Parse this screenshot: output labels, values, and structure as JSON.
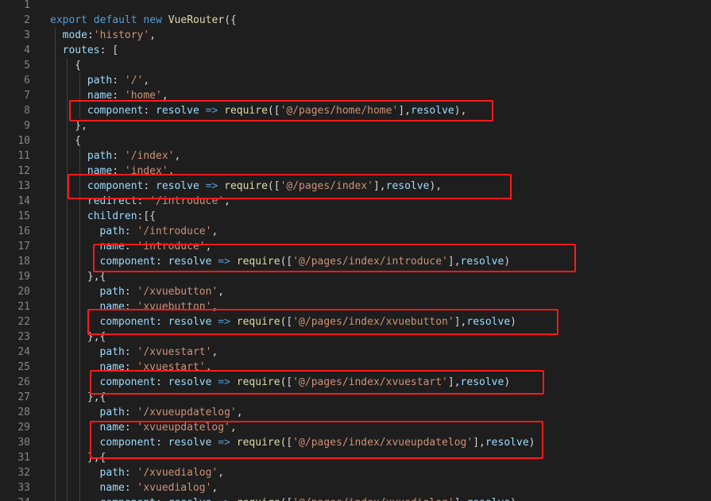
{
  "editor": {
    "background": "#1e1e1e",
    "highlight_color": "#ff1a1a"
  },
  "lines": [
    {
      "n": "1",
      "indent": 0,
      "tokens": []
    },
    {
      "n": "2",
      "indent": 0,
      "tokens": [
        [
          "kw",
          "export"
        ],
        [
          "pun",
          " "
        ],
        [
          "kw",
          "default"
        ],
        [
          "pun",
          " "
        ],
        [
          "kw",
          "new"
        ],
        [
          "pun",
          " "
        ],
        [
          "fn",
          "VueRouter"
        ],
        [
          "pun",
          "({"
        ]
      ]
    },
    {
      "n": "3",
      "indent": 2,
      "tokens": [
        [
          "prop",
          "mode"
        ],
        [
          "pun",
          ":"
        ],
        [
          "str",
          "'history'"
        ],
        [
          "pun",
          ","
        ]
      ]
    },
    {
      "n": "4",
      "indent": 2,
      "tokens": [
        [
          "prop",
          "routes"
        ],
        [
          "pun",
          ": ["
        ]
      ]
    },
    {
      "n": "5",
      "indent": 4,
      "tokens": [
        [
          "pun",
          "{"
        ]
      ]
    },
    {
      "n": "6",
      "indent": 6,
      "tokens": [
        [
          "prop",
          "path"
        ],
        [
          "pun",
          ": "
        ],
        [
          "str",
          "'/'"
        ],
        [
          "pun",
          ","
        ]
      ]
    },
    {
      "n": "7",
      "indent": 6,
      "tokens": [
        [
          "prop",
          "name"
        ],
        [
          "pun",
          ": "
        ],
        [
          "str",
          "'home'"
        ],
        [
          "pun",
          ","
        ]
      ]
    },
    {
      "n": "8",
      "indent": 6,
      "tokens": [
        [
          "prop",
          "component"
        ],
        [
          "pun",
          ": "
        ],
        [
          "prop",
          "resolve"
        ],
        [
          "pun",
          " "
        ],
        [
          "kw",
          "=>"
        ],
        [
          "pun",
          " "
        ],
        [
          "fn",
          "require"
        ],
        [
          "pun",
          "(["
        ],
        [
          "str",
          "'@/pages/home/home'"
        ],
        [
          "pun",
          "],"
        ],
        [
          "prop",
          "resolve"
        ],
        [
          "pun",
          "),"
        ]
      ]
    },
    {
      "n": "9",
      "indent": 4,
      "tokens": [
        [
          "pun",
          "},"
        ]
      ]
    },
    {
      "n": "10",
      "indent": 4,
      "tokens": [
        [
          "pun",
          "{"
        ]
      ]
    },
    {
      "n": "11",
      "indent": 6,
      "tokens": [
        [
          "prop",
          "path"
        ],
        [
          "pun",
          ": "
        ],
        [
          "str",
          "'/index'"
        ],
        [
          "pun",
          ","
        ]
      ]
    },
    {
      "n": "12",
      "indent": 6,
      "tokens": [
        [
          "prop",
          "name"
        ],
        [
          "pun",
          ": "
        ],
        [
          "str",
          "'index'"
        ],
        [
          "pun",
          ","
        ]
      ]
    },
    {
      "n": "13",
      "indent": 6,
      "tokens": [
        [
          "prop",
          "component"
        ],
        [
          "pun",
          ": "
        ],
        [
          "prop",
          "resolve"
        ],
        [
          "pun",
          " "
        ],
        [
          "kw",
          "=>"
        ],
        [
          "pun",
          " "
        ],
        [
          "fn",
          "require"
        ],
        [
          "pun",
          "(["
        ],
        [
          "str",
          "'@/pages/index'"
        ],
        [
          "pun",
          "],"
        ],
        [
          "prop",
          "resolve"
        ],
        [
          "pun",
          "),"
        ]
      ]
    },
    {
      "n": "14",
      "indent": 6,
      "tokens": [
        [
          "prop",
          "redirect"
        ],
        [
          "pun",
          ": "
        ],
        [
          "str",
          "'/introduce'"
        ],
        [
          "pun",
          ","
        ]
      ]
    },
    {
      "n": "15",
      "indent": 6,
      "tokens": [
        [
          "prop",
          "children"
        ],
        [
          "pun",
          ":[{"
        ]
      ]
    },
    {
      "n": "16",
      "indent": 8,
      "tokens": [
        [
          "prop",
          "path"
        ],
        [
          "pun",
          ": "
        ],
        [
          "str",
          "'/introduce'"
        ],
        [
          "pun",
          ","
        ]
      ]
    },
    {
      "n": "17",
      "indent": 8,
      "tokens": [
        [
          "prop",
          "name"
        ],
        [
          "pun",
          ": "
        ],
        [
          "str",
          "'introduce'"
        ],
        [
          "pun",
          ","
        ]
      ]
    },
    {
      "n": "18",
      "indent": 8,
      "tokens": [
        [
          "prop",
          "component"
        ],
        [
          "pun",
          ": "
        ],
        [
          "prop",
          "resolve"
        ],
        [
          "pun",
          " "
        ],
        [
          "kw",
          "=>"
        ],
        [
          "pun",
          " "
        ],
        [
          "fn",
          "require"
        ],
        [
          "pun",
          "(["
        ],
        [
          "str",
          "'@/pages/index/introduce'"
        ],
        [
          "pun",
          "],"
        ],
        [
          "prop",
          "resolve"
        ],
        [
          "pun",
          ")"
        ]
      ]
    },
    {
      "n": "19",
      "indent": 6,
      "tokens": [
        [
          "pun",
          "},{"
        ]
      ]
    },
    {
      "n": "20",
      "indent": 8,
      "tokens": [
        [
          "prop",
          "path"
        ],
        [
          "pun",
          ": "
        ],
        [
          "str",
          "'/xvuebutton'"
        ],
        [
          "pun",
          ","
        ]
      ]
    },
    {
      "n": "21",
      "indent": 8,
      "tokens": [
        [
          "prop",
          "name"
        ],
        [
          "pun",
          ": "
        ],
        [
          "str",
          "'xvuebutton'"
        ],
        [
          "pun",
          ","
        ]
      ]
    },
    {
      "n": "22",
      "indent": 8,
      "tokens": [
        [
          "prop",
          "component"
        ],
        [
          "pun",
          ": "
        ],
        [
          "prop",
          "resolve"
        ],
        [
          "pun",
          " "
        ],
        [
          "kw",
          "=>"
        ],
        [
          "pun",
          " "
        ],
        [
          "fn",
          "require"
        ],
        [
          "pun",
          "(["
        ],
        [
          "str",
          "'@/pages/index/xvuebutton'"
        ],
        [
          "pun",
          "],"
        ],
        [
          "prop",
          "resolve"
        ],
        [
          "pun",
          ")"
        ]
      ]
    },
    {
      "n": "23",
      "indent": 6,
      "tokens": [
        [
          "pun",
          "},{"
        ]
      ]
    },
    {
      "n": "24",
      "indent": 8,
      "tokens": [
        [
          "prop",
          "path"
        ],
        [
          "pun",
          ": "
        ],
        [
          "str",
          "'/xvuestart'"
        ],
        [
          "pun",
          ","
        ]
      ]
    },
    {
      "n": "25",
      "indent": 8,
      "tokens": [
        [
          "prop",
          "name"
        ],
        [
          "pun",
          ": "
        ],
        [
          "str",
          "'xvuestart'"
        ],
        [
          "pun",
          ","
        ]
      ]
    },
    {
      "n": "26",
      "indent": 8,
      "tokens": [
        [
          "prop",
          "component"
        ],
        [
          "pun",
          ": "
        ],
        [
          "prop",
          "resolve"
        ],
        [
          "pun",
          " "
        ],
        [
          "kw",
          "=>"
        ],
        [
          "pun",
          " "
        ],
        [
          "fn",
          "require"
        ],
        [
          "pun",
          "(["
        ],
        [
          "str",
          "'@/pages/index/xvuestart'"
        ],
        [
          "pun",
          "],"
        ],
        [
          "prop",
          "resolve"
        ],
        [
          "pun",
          ")"
        ]
      ]
    },
    {
      "n": "27",
      "indent": 6,
      "tokens": [
        [
          "pun",
          "},{"
        ]
      ]
    },
    {
      "n": "28",
      "indent": 8,
      "tokens": [
        [
          "prop",
          "path"
        ],
        [
          "pun",
          ": "
        ],
        [
          "str",
          "'/xvueupdatelog'"
        ],
        [
          "pun",
          ","
        ]
      ]
    },
    {
      "n": "29",
      "indent": 8,
      "tokens": [
        [
          "prop",
          "name"
        ],
        [
          "pun",
          ": "
        ],
        [
          "str",
          "'xvueupdatelog'"
        ],
        [
          "pun",
          ","
        ]
      ]
    },
    {
      "n": "30",
      "indent": 8,
      "tokens": [
        [
          "prop",
          "component"
        ],
        [
          "pun",
          ": "
        ],
        [
          "prop",
          "resolve"
        ],
        [
          "pun",
          " "
        ],
        [
          "kw",
          "=>"
        ],
        [
          "pun",
          " "
        ],
        [
          "fn",
          "require"
        ],
        [
          "pun",
          "(["
        ],
        [
          "str",
          "'@/pages/index/xvueupdatelog'"
        ],
        [
          "pun",
          "],"
        ],
        [
          "prop",
          "resolve"
        ],
        [
          "pun",
          ")"
        ]
      ]
    },
    {
      "n": "31",
      "indent": 6,
      "tokens": [
        [
          "pun",
          "},{"
        ]
      ]
    },
    {
      "n": "32",
      "indent": 8,
      "tokens": [
        [
          "prop",
          "path"
        ],
        [
          "pun",
          ": "
        ],
        [
          "str",
          "'/xvuedialog'"
        ],
        [
          "pun",
          ","
        ]
      ]
    },
    {
      "n": "33",
      "indent": 8,
      "tokens": [
        [
          "prop",
          "name"
        ],
        [
          "pun",
          ": "
        ],
        [
          "str",
          "'xvuedialog'"
        ],
        [
          "pun",
          ","
        ]
      ]
    },
    {
      "n": "34",
      "indent": 8,
      "tokens": [
        [
          "prop",
          "component"
        ],
        [
          "pun",
          ": "
        ],
        [
          "prop",
          "resolve"
        ],
        [
          "pun",
          " "
        ],
        [
          "kw",
          "=>"
        ],
        [
          "pun",
          " "
        ],
        [
          "fn",
          "require"
        ],
        [
          "pun",
          "(["
        ],
        [
          "str",
          "'@/pages/index/xvuedialog'"
        ],
        [
          "pun",
          "],"
        ],
        [
          "prop",
          "resolve"
        ],
        [
          "pun",
          ")"
        ]
      ]
    }
  ]
}
